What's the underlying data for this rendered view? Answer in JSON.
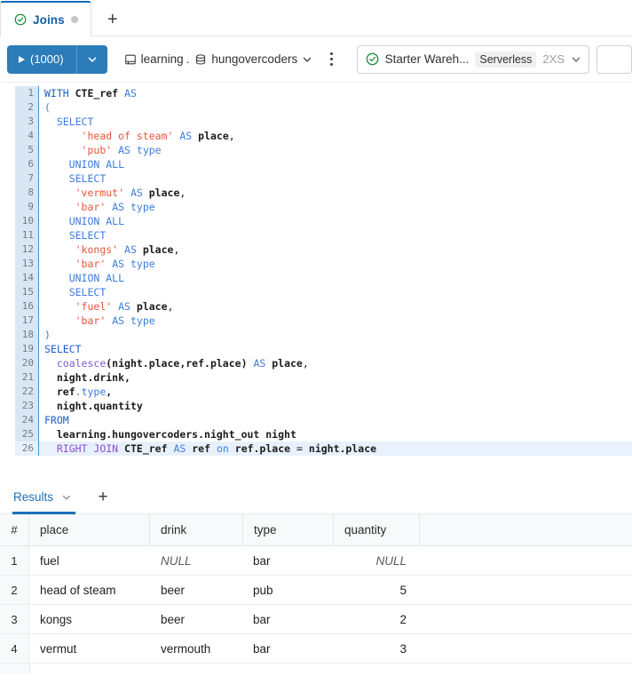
{
  "tabs": {
    "active": {
      "label": "Joins",
      "status_icon": "check-circle-icon",
      "dirty_dot": "●"
    },
    "add_label": "+"
  },
  "toolbar": {
    "run_label": "(1000)",
    "run_caret_icon": "chevron-down-icon",
    "catalog": "learning",
    "catalog_separator": ".",
    "schema": "hungovercoders",
    "context_caret_icon": "chevron-down-icon",
    "kebab_icon": "more-vertical-icon",
    "warehouse": {
      "status_icon": "check-circle-icon",
      "name": "Starter Wareh...",
      "type": "Serverless",
      "size": "2XS",
      "caret_icon": "chevron-down-icon"
    }
  },
  "editor": {
    "lines": [
      {
        "n": "1",
        "tokens": [
          {
            "t": "WITH ",
            "c": "kw2"
          },
          {
            "t": "CTE_ref ",
            "c": "id"
          },
          {
            "t": "AS",
            "c": "kw"
          }
        ]
      },
      {
        "n": "2",
        "tokens": [
          {
            "t": "(",
            "c": "kw"
          }
        ]
      },
      {
        "n": "3",
        "tokens": [
          {
            "t": "  ",
            "c": "pl"
          },
          {
            "t": "SELECT",
            "c": "kw"
          }
        ]
      },
      {
        "n": "4",
        "tokens": [
          {
            "t": "      ",
            "c": "pl"
          },
          {
            "t": "'head of steam'",
            "c": "str"
          },
          {
            "t": " ",
            "c": "pl"
          },
          {
            "t": "AS",
            "c": "kw"
          },
          {
            "t": " ",
            "c": "pl"
          },
          {
            "t": "place",
            "c": "id"
          },
          {
            "t": ",",
            "c": "pl"
          }
        ]
      },
      {
        "n": "5",
        "tokens": [
          {
            "t": "      ",
            "c": "pl"
          },
          {
            "t": "'pub'",
            "c": "str"
          },
          {
            "t": " ",
            "c": "pl"
          },
          {
            "t": "AS",
            "c": "kw"
          },
          {
            "t": " ",
            "c": "pl"
          },
          {
            "t": "type",
            "c": "kw"
          }
        ]
      },
      {
        "n": "6",
        "tokens": [
          {
            "t": "    ",
            "c": "pl"
          },
          {
            "t": "UNION ALL",
            "c": "kw"
          }
        ]
      },
      {
        "n": "7",
        "tokens": [
          {
            "t": "    ",
            "c": "pl"
          },
          {
            "t": "SELECT",
            "c": "kw"
          }
        ]
      },
      {
        "n": "8",
        "tokens": [
          {
            "t": "     ",
            "c": "pl"
          },
          {
            "t": "'vermut'",
            "c": "str"
          },
          {
            "t": " ",
            "c": "pl"
          },
          {
            "t": "AS",
            "c": "kw"
          },
          {
            "t": " ",
            "c": "pl"
          },
          {
            "t": "place",
            "c": "id"
          },
          {
            "t": ",",
            "c": "pl"
          }
        ]
      },
      {
        "n": "9",
        "tokens": [
          {
            "t": "     ",
            "c": "pl"
          },
          {
            "t": "'bar'",
            "c": "str"
          },
          {
            "t": " ",
            "c": "pl"
          },
          {
            "t": "AS",
            "c": "kw"
          },
          {
            "t": " ",
            "c": "pl"
          },
          {
            "t": "type",
            "c": "kw"
          }
        ]
      },
      {
        "n": "10",
        "tokens": [
          {
            "t": "    ",
            "c": "pl"
          },
          {
            "t": "UNION ALL",
            "c": "kw"
          }
        ]
      },
      {
        "n": "11",
        "tokens": [
          {
            "t": "    ",
            "c": "pl"
          },
          {
            "t": "SELECT",
            "c": "kw"
          }
        ]
      },
      {
        "n": "12",
        "tokens": [
          {
            "t": "     ",
            "c": "pl"
          },
          {
            "t": "'kongs'",
            "c": "str"
          },
          {
            "t": " ",
            "c": "pl"
          },
          {
            "t": "AS",
            "c": "kw"
          },
          {
            "t": " ",
            "c": "pl"
          },
          {
            "t": "place",
            "c": "id"
          },
          {
            "t": ",",
            "c": "pl"
          }
        ]
      },
      {
        "n": "13",
        "tokens": [
          {
            "t": "     ",
            "c": "pl"
          },
          {
            "t": "'bar'",
            "c": "str"
          },
          {
            "t": " ",
            "c": "pl"
          },
          {
            "t": "AS",
            "c": "kw"
          },
          {
            "t": " ",
            "c": "pl"
          },
          {
            "t": "type",
            "c": "kw"
          }
        ]
      },
      {
        "n": "14",
        "tokens": [
          {
            "t": "    ",
            "c": "pl"
          },
          {
            "t": "UNION ALL",
            "c": "kw"
          }
        ]
      },
      {
        "n": "15",
        "tokens": [
          {
            "t": "    ",
            "c": "pl"
          },
          {
            "t": "SELECT",
            "c": "kw"
          }
        ]
      },
      {
        "n": "16",
        "tokens": [
          {
            "t": "     ",
            "c": "pl"
          },
          {
            "t": "'fuel'",
            "c": "str"
          },
          {
            "t": " ",
            "c": "pl"
          },
          {
            "t": "AS",
            "c": "kw"
          },
          {
            "t": " ",
            "c": "pl"
          },
          {
            "t": "place",
            "c": "id"
          },
          {
            "t": ",",
            "c": "pl"
          }
        ]
      },
      {
        "n": "17",
        "tokens": [
          {
            "t": "     ",
            "c": "pl"
          },
          {
            "t": "'bar'",
            "c": "str"
          },
          {
            "t": " ",
            "c": "pl"
          },
          {
            "t": "AS",
            "c": "kw"
          },
          {
            "t": " ",
            "c": "pl"
          },
          {
            "t": "type",
            "c": "kw"
          }
        ]
      },
      {
        "n": "18",
        "tokens": [
          {
            "t": ")",
            "c": "kw"
          }
        ]
      },
      {
        "n": "19",
        "tokens": [
          {
            "t": "SELECT",
            "c": "kw2"
          }
        ]
      },
      {
        "n": "20",
        "tokens": [
          {
            "t": "  ",
            "c": "pl"
          },
          {
            "t": "coalesce",
            "c": "fn"
          },
          {
            "t": "(night.place,ref.place)",
            "c": "id"
          },
          {
            "t": " ",
            "c": "pl"
          },
          {
            "t": "AS",
            "c": "kw"
          },
          {
            "t": " ",
            "c": "pl"
          },
          {
            "t": "place",
            "c": "id"
          },
          {
            "t": ",",
            "c": "pl"
          }
        ]
      },
      {
        "n": "21",
        "tokens": [
          {
            "t": "  ",
            "c": "pl"
          },
          {
            "t": "night.drink,",
            "c": "id"
          }
        ]
      },
      {
        "n": "22",
        "tokens": [
          {
            "t": "  ",
            "c": "pl"
          },
          {
            "t": "ref",
            "c": "id"
          },
          {
            "t": ".type",
            "c": "kw"
          },
          {
            "t": ",",
            "c": "id"
          }
        ]
      },
      {
        "n": "23",
        "tokens": [
          {
            "t": "  ",
            "c": "pl"
          },
          {
            "t": "night.quantity",
            "c": "id"
          }
        ]
      },
      {
        "n": "24",
        "tokens": [
          {
            "t": "FROM",
            "c": "kw2"
          }
        ]
      },
      {
        "n": "25",
        "tokens": [
          {
            "t": "  ",
            "c": "pl"
          },
          {
            "t": "learning.hungovercoders.night_out night",
            "c": "id"
          }
        ]
      },
      {
        "n": "26",
        "active": true,
        "tokens": [
          {
            "t": "  ",
            "c": "pl"
          },
          {
            "t": "RIGHT JOIN",
            "c": "pur"
          },
          {
            "t": " ",
            "c": "pl"
          },
          {
            "t": "CTE_ref",
            "c": "id"
          },
          {
            "t": " ",
            "c": "pl"
          },
          {
            "t": "AS",
            "c": "kw"
          },
          {
            "t": " ",
            "c": "pl"
          },
          {
            "t": "ref",
            "c": "id"
          },
          {
            "t": " ",
            "c": "pl"
          },
          {
            "t": "on",
            "c": "kw"
          },
          {
            "t": " ",
            "c": "pl"
          },
          {
            "t": "ref.place",
            "c": "id"
          },
          {
            "t": " ",
            "c": "pl"
          },
          {
            "t": "=",
            "c": "pl"
          },
          {
            "t": " ",
            "c": "pl"
          },
          {
            "t": "night.place",
            "c": "id"
          }
        ]
      }
    ]
  },
  "results": {
    "tab_label": "Results",
    "tab_caret_icon": "chevron-down-icon",
    "add_label": "+",
    "columns": [
      "#",
      "place",
      "drink",
      "type",
      "quantity"
    ],
    "rows": [
      {
        "idx": "1",
        "place": "fuel",
        "drink": "NULL",
        "type": "bar",
        "quantity": "NULL"
      },
      {
        "idx": "2",
        "place": "head of steam",
        "drink": "beer",
        "type": "pub",
        "quantity": "5"
      },
      {
        "idx": "3",
        "place": "kongs",
        "drink": "beer",
        "type": "bar",
        "quantity": "2"
      },
      {
        "idx": "4",
        "place": "vermut",
        "drink": "vermouth",
        "type": "bar",
        "quantity": "3"
      }
    ]
  },
  "colors": {
    "accent": "#0f6cbd",
    "run_button": "#2b7cb9",
    "tab_link": "#115ea3",
    "gutter": "#d9e7f4",
    "active_line": "#e8f1fb",
    "string": "#e8553a",
    "keyword": "#3b7ddd",
    "function": "#7a5ad6",
    "join_keyword": "#8a4fd3",
    "status_ok": "#1a8f3c"
  }
}
